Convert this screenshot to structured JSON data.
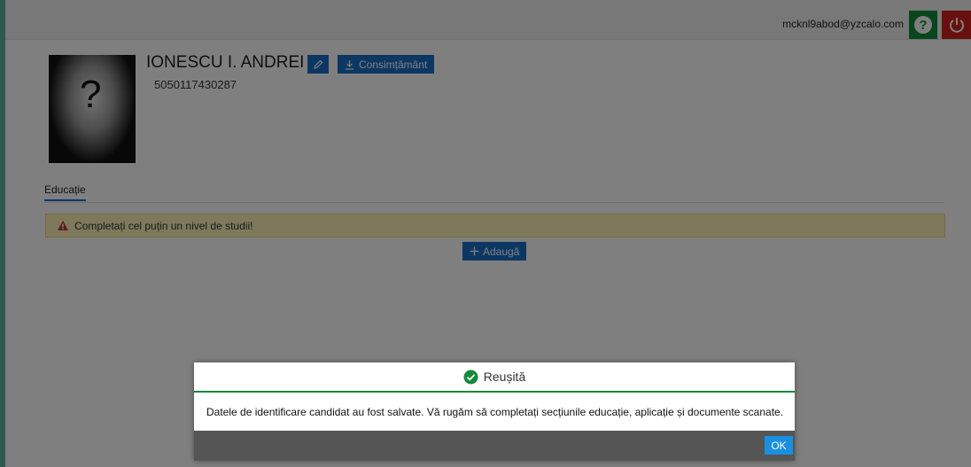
{
  "header": {
    "user_email": "mcknl9abod@yzcalo.com",
    "help_label": "?"
  },
  "candidate": {
    "name": "IONESCU I. ANDREI",
    "cnp": "5050117430287",
    "photo_placeholder": "?",
    "consent_button": "Consimțământ"
  },
  "tabs": [
    {
      "label": "Educație",
      "active": true
    }
  ],
  "education": {
    "warning": "Completați cel puțin un nivel de studii!",
    "add_button": "Adaugă"
  },
  "modal": {
    "title": "Reușită",
    "message": "Datele de identificare candidat au fost salvate. Vă rugăm să completați secțiunile educație, aplicație și documente scanate.",
    "ok_button": "OK"
  },
  "colors": {
    "primary": "#1a6fc6",
    "success": "#138a3a",
    "danger": "#d0201c",
    "warning_bg": "#fdf3b5"
  }
}
